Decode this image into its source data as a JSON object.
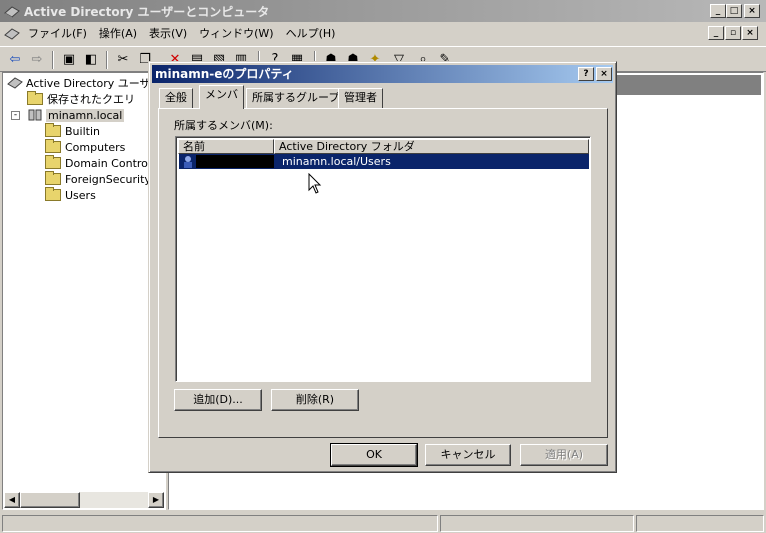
{
  "window": {
    "title": "Active Directory ユーザーとコンピュータ"
  },
  "menu": [
    "ファイル(F)",
    "操作(A)",
    "表示(V)",
    "ウィンドウ(W)",
    "ヘルプ(H)"
  ],
  "tree": {
    "root": "Active Directory ユーザ",
    "saved_queries": "保存されたクエリ",
    "domain": "minamn.local",
    "children": [
      "Builtin",
      "Computers",
      "Domain Controll",
      "ForeignSecurityl",
      "Users"
    ]
  },
  "dialog": {
    "title": "minamn-eのプロパティ",
    "help_btn": "?",
    "close_btn": "×",
    "tabs": [
      "全般",
      "メンバ",
      "所属するグループ",
      "管理者"
    ],
    "members_label": "所属するメンバ(M):",
    "columns": [
      "名前",
      "Active Directory フォルダ"
    ],
    "rows": [
      {
        "name": "",
        "folder": "minamn.local/Users"
      }
    ],
    "add_btn": "追加(D)...",
    "remove_btn": "削除(R)",
    "ok_btn": "OK",
    "cancel_btn": "キャンセル",
    "apply_btn": "適用(A)"
  },
  "colors": {
    "selection": "#0a246a",
    "title_active": "#0a246a"
  }
}
